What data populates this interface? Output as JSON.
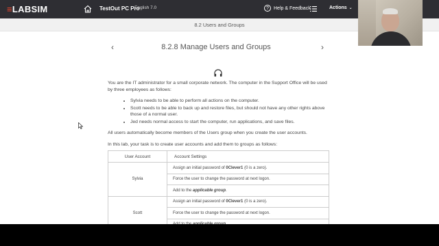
{
  "topbar": {
    "logo_mark": "≡",
    "logo_text": "LABSIM",
    "course": "TestOut PC Pro",
    "language": "English 7.0",
    "help": "Help & Feedback",
    "actions": "Actions"
  },
  "subbar": {
    "section": "8.2 Users and Groups"
  },
  "page": {
    "title": "8.2.8 Manage Users and Groups",
    "prev_glyph": "‹",
    "next_glyph": "›"
  },
  "content": {
    "intro": "You are the IT administrator for a small corporate network. The computer in the Support Office will be used by three employees as follows:",
    "bullets": [
      "Sylvia needs to be able to perform all actions on the computer.",
      "Scott needs to be able to back up and restore files, but should not have any other rights above those of a normal user.",
      "Jed needs normal access to start the computer, run applications, and save files."
    ],
    "para2": "All users automatically become members of the Users group when you create the user accounts.",
    "para3": "In this lab, your task is to create user accounts and add them to groups as follows:"
  },
  "table": {
    "headers": [
      "User Account",
      "Account Settings"
    ],
    "rows": [
      {
        "user": "Sylvia",
        "settings": [
          {
            "pre": "Assign an initial password of ",
            "bold": "0Clever1",
            "post": " (0 is a zero)."
          },
          {
            "pre": "Force the user to change the password at next logon.",
            "bold": "",
            "post": ""
          },
          {
            "pre": "Add to the ",
            "bold": "applicable group",
            "post": "."
          }
        ]
      },
      {
        "user": "Scott",
        "settings": [
          {
            "pre": "Assign an initial password of ",
            "bold": "0Clever1",
            "post": " (0 is a zero)."
          },
          {
            "pre": "Force the user to change the password at next logon.",
            "bold": "",
            "post": ""
          },
          {
            "pre": "Add to the ",
            "bold": "applicable group",
            "post": "."
          }
        ]
      }
    ]
  },
  "colors": {
    "topbar": "#2e2e33",
    "accent": "#e8452c",
    "subbar": "#f1f1f1"
  },
  "icons": [
    "home-icon",
    "help-icon",
    "menu-icon",
    "chevron-down-icon",
    "chevron-left-icon",
    "chevron-right-icon",
    "headphones-icon",
    "mouse-cursor-icon"
  ]
}
